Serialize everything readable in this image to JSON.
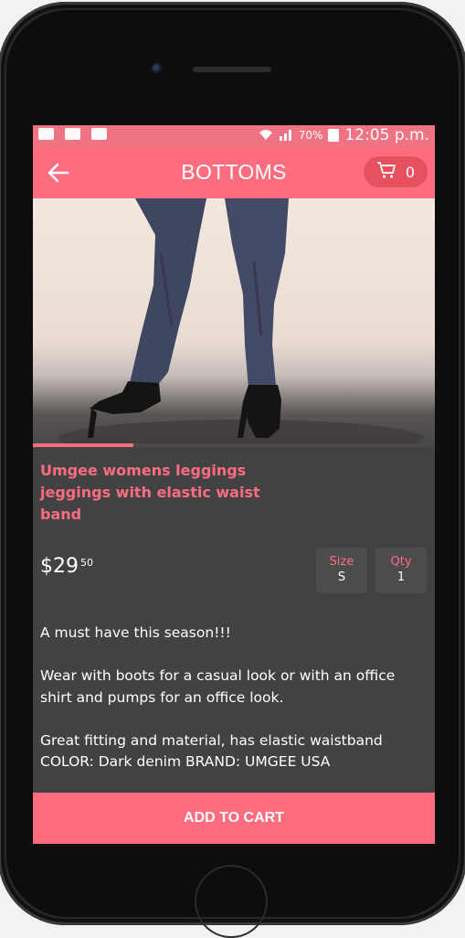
{
  "status_bar": {
    "signal": "70%",
    "time": "12:05 p.m."
  },
  "app_bar": {
    "title": "BOTTOMS",
    "cart_count": "0"
  },
  "product": {
    "image_progress": 0.25,
    "name": "Umgee womens leggings jeggings with elastic waist band",
    "price_main": "$29",
    "price_cents": "50",
    "size_label": "Size",
    "size_value": "S",
    "qty_label": "Qty",
    "qty_value": "1",
    "description": [
      "A must have this season!!!",
      "Wear with boots for a casual look or with an office shirt and pumps for an office look.",
      "Great fitting and material, has elastic waistband COLOR: Dark denim BRAND: UMGEE USA"
    ]
  },
  "actions": {
    "add_to_cart": "ADD TO CART"
  },
  "colors": {
    "accent": "#fe6d7f",
    "status_bar": "#f07383",
    "background": "#424243"
  }
}
